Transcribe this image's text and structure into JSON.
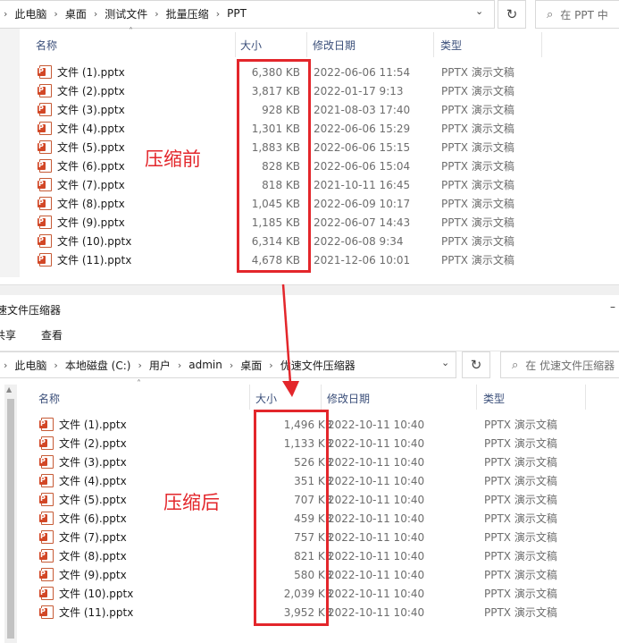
{
  "top": {
    "breadcrumb": [
      "此电脑",
      "桌面",
      "测试文件",
      "批量压缩",
      "PPT"
    ],
    "search_placeholder": "在 PPT 中",
    "headers": {
      "name": "名称",
      "size": "大小",
      "date": "修改日期",
      "type": "类型"
    },
    "rows": [
      {
        "name": "文件 (1).pptx",
        "size": "6,380 KB",
        "date": "2022-06-06 11:54",
        "type": "PPTX 演示文稿"
      },
      {
        "name": "文件 (2).pptx",
        "size": "3,817 KB",
        "date": "2022-01-17 9:13",
        "type": "PPTX 演示文稿"
      },
      {
        "name": "文件 (3).pptx",
        "size": "928 KB",
        "date": "2021-08-03 17:40",
        "type": "PPTX 演示文稿"
      },
      {
        "name": "文件 (4).pptx",
        "size": "1,301 KB",
        "date": "2022-06-06 15:29",
        "type": "PPTX 演示文稿"
      },
      {
        "name": "文件 (5).pptx",
        "size": "1,883 KB",
        "date": "2022-06-06 15:15",
        "type": "PPTX 演示文稿"
      },
      {
        "name": "文件 (6).pptx",
        "size": "828 KB",
        "date": "2022-06-06 15:04",
        "type": "PPTX 演示文稿"
      },
      {
        "name": "文件 (7).pptx",
        "size": "818 KB",
        "date": "2021-10-11 16:45",
        "type": "PPTX 演示文稿"
      },
      {
        "name": "文件 (8).pptx",
        "size": "1,045 KB",
        "date": "2022-06-09 10:17",
        "type": "PPTX 演示文稿"
      },
      {
        "name": "文件 (9).pptx",
        "size": "1,185 KB",
        "date": "2022-06-07 14:43",
        "type": "PPTX 演示文稿"
      },
      {
        "name": "文件 (10).pptx",
        "size": "6,314 KB",
        "date": "2022-06-08 9:34",
        "type": "PPTX 演示文稿"
      },
      {
        "name": "文件 (11).pptx",
        "size": "4,678 KB",
        "date": "2021-12-06 10:01",
        "type": "PPTX 演示文稿"
      }
    ],
    "annotation": "压缩前"
  },
  "bottom": {
    "window_title": "速文件压缩器",
    "ribbon": [
      "共享",
      "查看"
    ],
    "breadcrumb": [
      "此电脑",
      "本地磁盘 (C:)",
      "用户",
      "admin",
      "桌面",
      "优速文件压缩器"
    ],
    "search_placeholder": "在 优速文件压缩器",
    "headers": {
      "name": "名称",
      "size": "大小",
      "date": "修改日期",
      "type": "类型"
    },
    "rows": [
      {
        "name": "文件 (1).pptx",
        "size": "1,496 KB",
        "date": "2022-10-11 10:40",
        "type": "PPTX 演示文稿"
      },
      {
        "name": "文件 (2).pptx",
        "size": "1,133 KB",
        "date": "2022-10-11 10:40",
        "type": "PPTX 演示文稿"
      },
      {
        "name": "文件 (3).pptx",
        "size": "526 KB",
        "date": "2022-10-11 10:40",
        "type": "PPTX 演示文稿"
      },
      {
        "name": "文件 (4).pptx",
        "size": "351 KB",
        "date": "2022-10-11 10:40",
        "type": "PPTX 演示文稿"
      },
      {
        "name": "文件 (5).pptx",
        "size": "707 KB",
        "date": "2022-10-11 10:40",
        "type": "PPTX 演示文稿"
      },
      {
        "name": "文件 (6).pptx",
        "size": "459 KB",
        "date": "2022-10-11 10:40",
        "type": "PPTX 演示文稿"
      },
      {
        "name": "文件 (7).pptx",
        "size": "757 KB",
        "date": "2022-10-11 10:40",
        "type": "PPTX 演示文稿"
      },
      {
        "name": "文件 (8).pptx",
        "size": "821 KB",
        "date": "2022-10-11 10:40",
        "type": "PPTX 演示文稿"
      },
      {
        "name": "文件 (9).pptx",
        "size": "580 KB",
        "date": "2022-10-11 10:40",
        "type": "PPTX 演示文稿"
      },
      {
        "name": "文件 (10).pptx",
        "size": "2,039 KB",
        "date": "2022-10-11 10:40",
        "type": "PPTX 演示文稿"
      },
      {
        "name": "文件 (11).pptx",
        "size": "3,952 KB",
        "date": "2022-10-11 10:40",
        "type": "PPTX 演示文稿"
      }
    ],
    "annotation": "压缩后"
  },
  "colors": {
    "highlight": "#e3262b",
    "header_text": "#3b4f7a",
    "muted_text": "#6d6d6d"
  },
  "icons": [
    "chevron-right-icon",
    "chevron-down-icon",
    "refresh-icon",
    "search-icon",
    "pptx-file-icon",
    "sort-up-icon",
    "arrow-down-icon"
  ]
}
